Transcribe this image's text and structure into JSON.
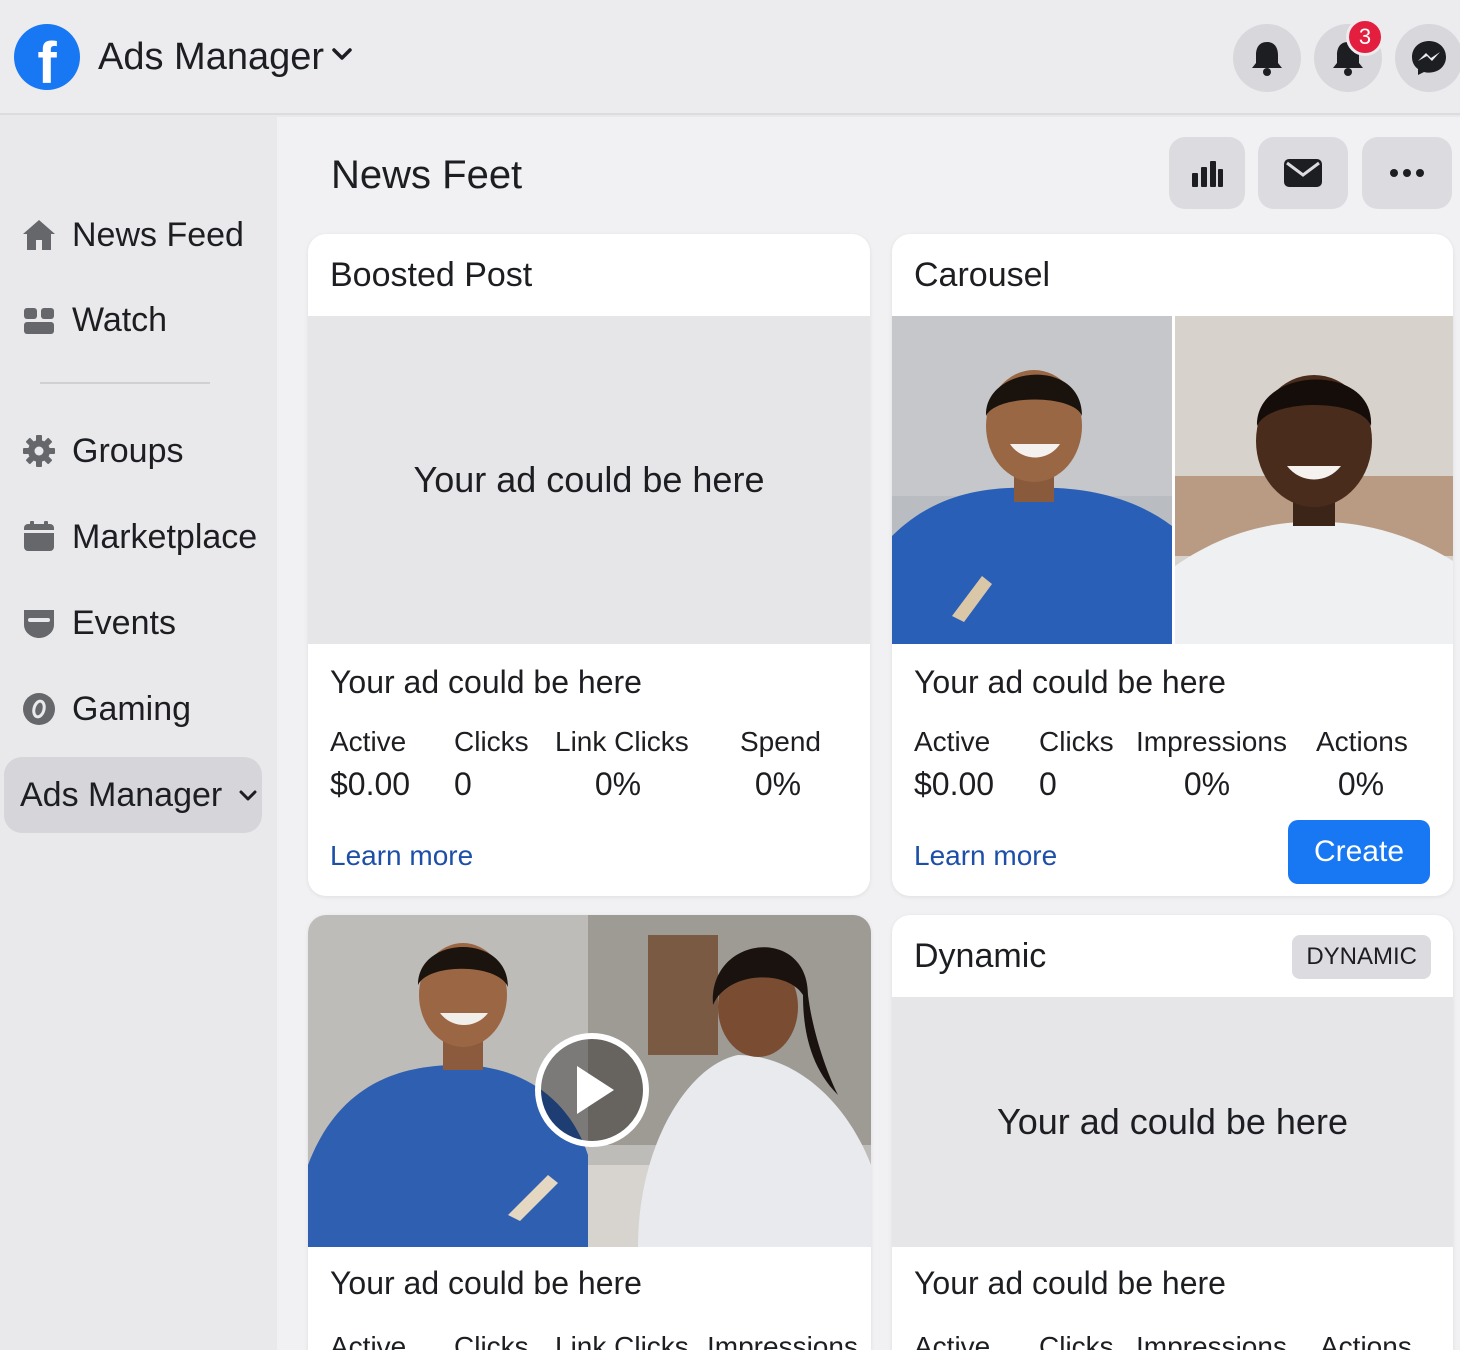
{
  "header": {
    "app_title": "Ads Manager",
    "notification_count": "3"
  },
  "sidebar": {
    "items": [
      {
        "label": "News Feed",
        "icon": "home-icon"
      },
      {
        "label": "Watch",
        "icon": "watch-icon"
      },
      {
        "label": "Groups",
        "icon": "gear-icon"
      },
      {
        "label": "Marketplace",
        "icon": "marketplace-icon"
      },
      {
        "label": "Events",
        "icon": "events-icon"
      },
      {
        "label": "Gaming",
        "icon": "gaming-icon"
      }
    ],
    "active": {
      "label": "Ads Manager"
    }
  },
  "main": {
    "title": "News Feet",
    "cards": {
      "boosted": {
        "title": "Boosted Post",
        "placeholder": "Your ad could be here",
        "text": "Your ad could be here",
        "stats": [
          {
            "label": "Active",
            "value": "$0.00"
          },
          {
            "label": "Clicks",
            "value": "0"
          },
          {
            "label": "Link Clicks",
            "value": "0%"
          },
          {
            "label": "Spend",
            "value": "0%"
          }
        ],
        "learn_more": "Learn more"
      },
      "carousel": {
        "title": "Carousel",
        "text": "Your ad could be here",
        "stats": [
          {
            "label": "Active",
            "value": "$0.00"
          },
          {
            "label": "Clicks",
            "value": "0"
          },
          {
            "label": "Impressions",
            "value": "0%"
          },
          {
            "label": "Actions",
            "value": "0%"
          }
        ],
        "learn_more": "Learn more",
        "create": "Create"
      },
      "video": {
        "text": "Your ad could be here",
        "stat_labels": [
          "Active",
          "Clicks",
          "Link Clicks",
          "Impressions"
        ]
      },
      "dynamic": {
        "title": "Dynamic",
        "tag": "DYNAMIC",
        "placeholder": "Your ad could be here",
        "text": "Your ad could be here",
        "stat_labels": [
          "Active",
          "Clicks",
          "Impressions",
          "Actions"
        ]
      }
    }
  },
  "colors": {
    "brand_blue": "#1877f2",
    "badge_red": "#e41e3f",
    "link_blue": "#1d4fa8"
  }
}
